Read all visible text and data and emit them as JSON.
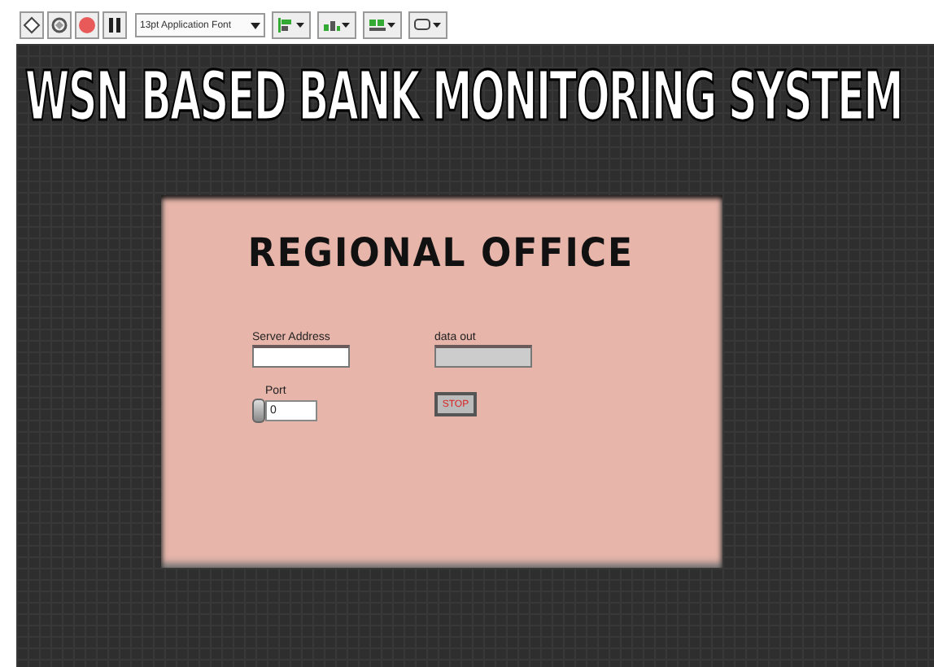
{
  "toolbar": {
    "font_menu": "13pt Application Font"
  },
  "panel": {
    "title": "WSN BASED BANK MONITORING SYSTEM",
    "office": {
      "title": "REGIONAL OFFICE",
      "server_address": {
        "label": "Server Address"
      },
      "data_out": {
        "label": "data out"
      },
      "port": {
        "label": "Port",
        "value": "0"
      },
      "stop_button": {
        "label": "STOP"
      }
    }
  }
}
